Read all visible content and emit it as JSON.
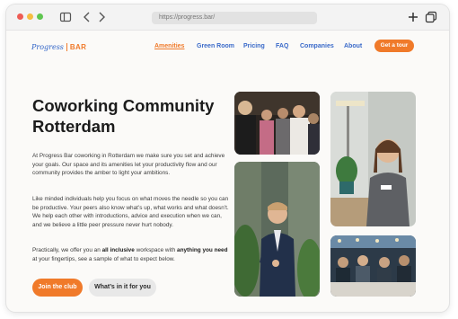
{
  "browser": {
    "url": "https://progress.bar/"
  },
  "nav": {
    "logo_script": "Progress",
    "logo_text": "BAR",
    "links": [
      "Amenities",
      "Green Room",
      "Pricing",
      "FAQ",
      "Companies",
      "About"
    ],
    "active_link": "Amenities",
    "cta": "Get a tour"
  },
  "hero": {
    "title": "Coworking Community Rotterdam",
    "paragraph1": "At Progress Bar coworking in Rotterdam we make sure you set and achieve your goals. Our space and its amenities let your productivity flow and our community provides the amber to light your ambitions.",
    "paragraph2": "Like minded individuals help you focus on what moves the needle so you can be productive. Your peers also know what’s up, what works and what doesn’t. We help each other with introductions, advice and execution when we can, and we believe a little peer pressure never hurt nobody.",
    "paragraph3": {
      "part1": "Practically, we offer you an ",
      "bold1": "all inclusive",
      "part2": " workspace with ",
      "bold2": "anything you need",
      "part3": " at your fingertips, see a sample of what to expect below."
    },
    "primary_button": "Join the club",
    "secondary_button": "What’s in it for you"
  },
  "colors": {
    "accent": "#f07a2a",
    "link": "#3a6ac9"
  }
}
